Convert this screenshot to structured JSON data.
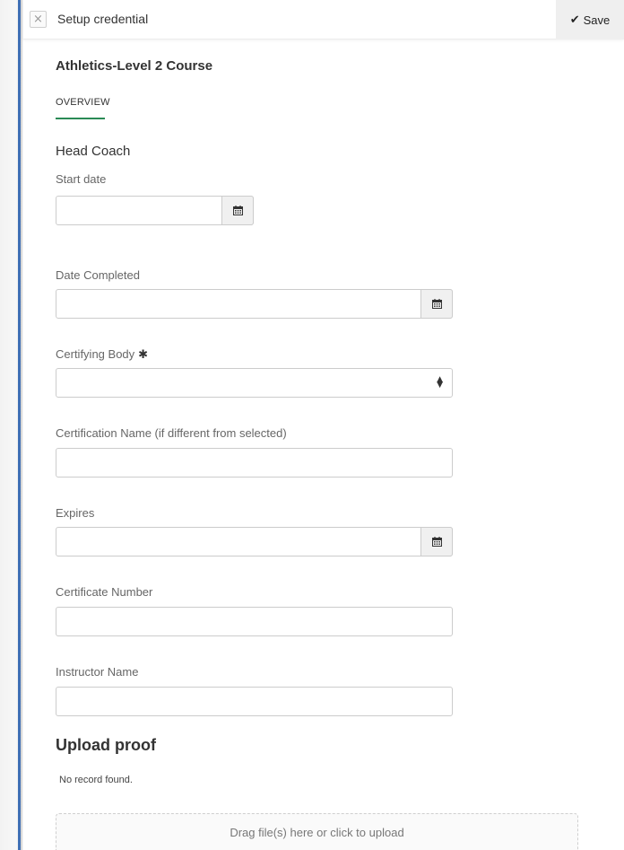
{
  "header": {
    "close_symbol": "×",
    "title": "Setup credential",
    "save_label": "Save",
    "save_icon": "✔"
  },
  "course": {
    "title": "Athletics-Level 2 Course"
  },
  "tabs": [
    {
      "label": "OVERVIEW",
      "active": true
    }
  ],
  "section": {
    "title": "Head Coach"
  },
  "form": {
    "start_date": {
      "label": "Start date",
      "value": "",
      "icon": "calendar-icon"
    },
    "date_completed": {
      "label": "Date Completed",
      "value": "",
      "icon": "calendar-icon"
    },
    "certifying_body": {
      "label": "Certifying Body",
      "required_marker": "✱",
      "value": "",
      "icon": "sort-arrows-icon"
    },
    "certification_name": {
      "label": "Certification Name (if different from selected)",
      "value": ""
    },
    "expires": {
      "label": "Expires",
      "value": "",
      "icon": "calendar-icon"
    },
    "certificate_number": {
      "label": "Certificate Number",
      "value": ""
    },
    "instructor_name": {
      "label": "Instructor Name",
      "value": ""
    }
  },
  "upload": {
    "title": "Upload proof",
    "empty_text": "No record found.",
    "dropzone_text": "Drag file(s) here or click to upload"
  },
  "colors": {
    "accent_tab_underline": "#2a8a55",
    "left_edge_bar": "#3f6fb5",
    "save_button_bg": "#efefef"
  }
}
